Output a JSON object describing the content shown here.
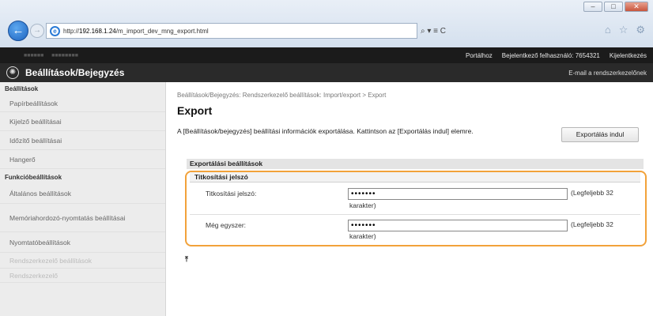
{
  "browser": {
    "url_prefix": "http://",
    "url_host": "192.168.1.24",
    "url_path": "/m_import_dev_mng_export.html",
    "search_symbols": "⌕ ▾ ≡ C",
    "window_buttons": [
      "–",
      "□",
      "✕"
    ]
  },
  "topbar": {
    "links": [
      "Portálhoz",
      "Bejelentkező felhasználó:  7654321",
      "Kijelentkezés"
    ]
  },
  "titlebar": {
    "title": "Beállítások/Bejegyzés",
    "mail_link": "E-mail a rendszerkezelőnek"
  },
  "sidebar": {
    "head1": "Beállítások",
    "items1": [
      "Papírbeállítások",
      "Kijelző beállításai",
      "Időzítő beállításai",
      "Hangerő"
    ],
    "head2": "Funkcióbeállítások",
    "items2": [
      "Általános beállítások",
      "Memóriahordozó-nyomtatás beállításai",
      "Nyomtatóbeállítások"
    ],
    "faded_items": [
      "Rendszerkezelő beállítások",
      "Rendszerkezelő"
    ]
  },
  "main": {
    "breadcrumb": "Beállítások/Bejegyzés: Rendszerkezelő beállítások: Import/export > Export",
    "title": "Export",
    "description": "A [Beállítások/bejegyzés] beállítási információk exportálása. Kattintson az [Exportálás indul] elemre.",
    "export_button": "Exportálás indul",
    "section_title": "Exportálási beállítások",
    "subsection_title": "Titkosítási jelszó",
    "fields": [
      {
        "label": "Titkosítási jelszó:",
        "value": "•••••••",
        "hint_a": "(Legfeljebb 32",
        "hint_b": "karakter)"
      },
      {
        "label": "Még egyszer:",
        "value": "•••••••",
        "hint_a": "(Legfeljebb 32",
        "hint_b": "karakter)"
      }
    ],
    "to_top": "⤒"
  },
  "colors": {
    "highlight_outline": "#f2a23a",
    "header_dark": "#1b1b1b"
  }
}
